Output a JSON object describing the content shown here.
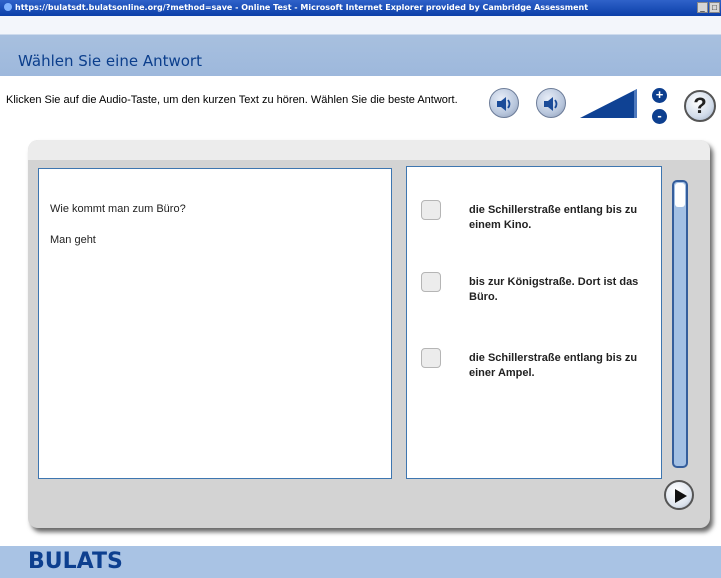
{
  "window": {
    "title": "https://bulatsdt.bulatsonline.org/?method=save - Online Test - Microsoft Internet Explorer provided by Cambridge Assessment",
    "minimize_label": "_",
    "maximize_label": "□"
  },
  "header": {
    "title": "Wählen Sie eine Antwort"
  },
  "instructions": {
    "text": "Klicken Sie auf die Audio-Taste, um den kurzen Text zu hören. Wählen Sie die beste Antwort."
  },
  "toolbar": {
    "audio_icon_1": "speaker-icon",
    "audio_icon_2": "speaker-icon",
    "volume_icon": "volume-ramp-icon",
    "zoom_in_label": "+",
    "zoom_out_label": "-",
    "help_label": "?"
  },
  "question": {
    "line1": "Wie kommt man zum Büro?",
    "line2": "Man geht"
  },
  "options": [
    {
      "text": "die Schillerstraße entlang bis zu einem Kino.",
      "checked": false
    },
    {
      "text": "bis zur Königstraße. Dort ist das Büro.",
      "checked": false
    },
    {
      "text": "die Schillerstraße entlang bis zu einer Ampel.",
      "checked": false
    }
  ],
  "navigation": {
    "next_icon": "play-arrow-icon"
  },
  "footer": {
    "brand": "BULATS"
  },
  "colors": {
    "brand_blue": "#0d3f8f",
    "panel_border": "#3e76b0",
    "header_band": "#9db8dc",
    "footer_band": "#a9c3e4"
  }
}
